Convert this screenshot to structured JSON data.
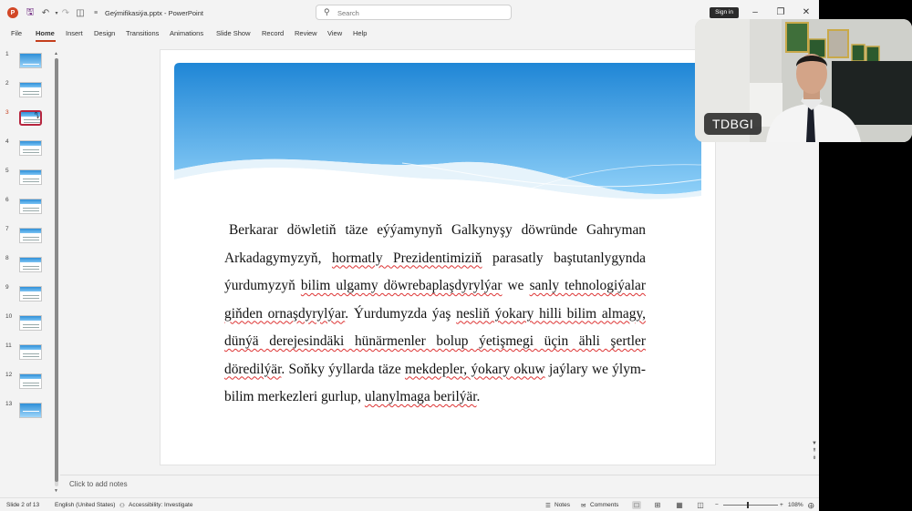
{
  "titlebar": {
    "doc_name": "Geýmifikasiýa.pptx",
    "separator": "-",
    "app_name": "PowerPoint",
    "search_placeholder": "Search",
    "signin_label": "Sign in"
  },
  "menu": [
    "File",
    "Home",
    "Insert",
    "Design",
    "Transitions",
    "Animations",
    "Slide Show",
    "Record",
    "Review",
    "View",
    "Help"
  ],
  "active_menu": "Home",
  "thumbnails": [
    "1",
    "2",
    "3",
    "4",
    "5",
    "6",
    "7",
    "8",
    "9",
    "10",
    "11",
    "12",
    "13"
  ],
  "selected_slide": "3",
  "slide": {
    "paragraph_parts": [
      {
        "t": "Berkarar döwletiň täze eýýamynyň Galkynyşy döwründe Gahryman Arkadagymyzyň, ",
        "s": false
      },
      {
        "t": "hormatly Prezidentimiziň",
        "s": true
      },
      {
        "t": " parasatly baştutanlygynda ýurdumyzyň ",
        "s": false
      },
      {
        "t": "bilim ulgamy döwrebaplaşdyrylýar",
        "s": true
      },
      {
        "t": " we ",
        "s": false
      },
      {
        "t": "sanly tehnologiýalar giňden ornaşdyrylýar",
        "s": true
      },
      {
        "t": ". Ýurdumyzda ýaş ",
        "s": false
      },
      {
        "t": "nesliň ýokary hilli bilim almagy, dünýä derejesindäki hünärmenler bolup ýetişmegi üçin ähli şertler döredilýär",
        "s": true
      },
      {
        "t": ". Soňky ýyllarda täze ",
        "s": false
      },
      {
        "t": "mekdepler, ýokary okuw",
        "s": true
      },
      {
        "t": " jaýlary we ýlym-bilim merkezleri gurlup, ",
        "s": false
      },
      {
        "t": "ulanylmaga berilýär",
        "s": true
      },
      {
        "t": ".",
        "s": false
      }
    ]
  },
  "notes_placeholder": "Click to add notes",
  "status": {
    "slide_indicator": "Slide 2 of 13",
    "language": "English (United States)",
    "accessibility": "Accessibility: Investigate",
    "notes_label": "Notes",
    "comments_label": "Comments",
    "zoom_minus": "−",
    "zoom_plus": "+",
    "zoom": "108%"
  },
  "webcam": {
    "label": "TDBGI"
  },
  "colors": {
    "accent": "#c43e1c",
    "selection": "#b7263f",
    "banner_top": "#1f86d6",
    "banner_bottom": "#8fd0f8",
    "squiggle": "#dd3333"
  },
  "icons": [
    "powerpoint-logo-icon",
    "save-icon",
    "undo-icon",
    "redo-icon",
    "present-icon",
    "customize-icon",
    "search-icon",
    "minimize-icon",
    "maximize-icon",
    "close-icon",
    "accessibility-icon",
    "notes-icon",
    "comments-icon",
    "normal-view-icon",
    "slide-sorter-icon",
    "reading-view-icon",
    "slideshow-icon",
    "fit-slide-icon"
  ]
}
